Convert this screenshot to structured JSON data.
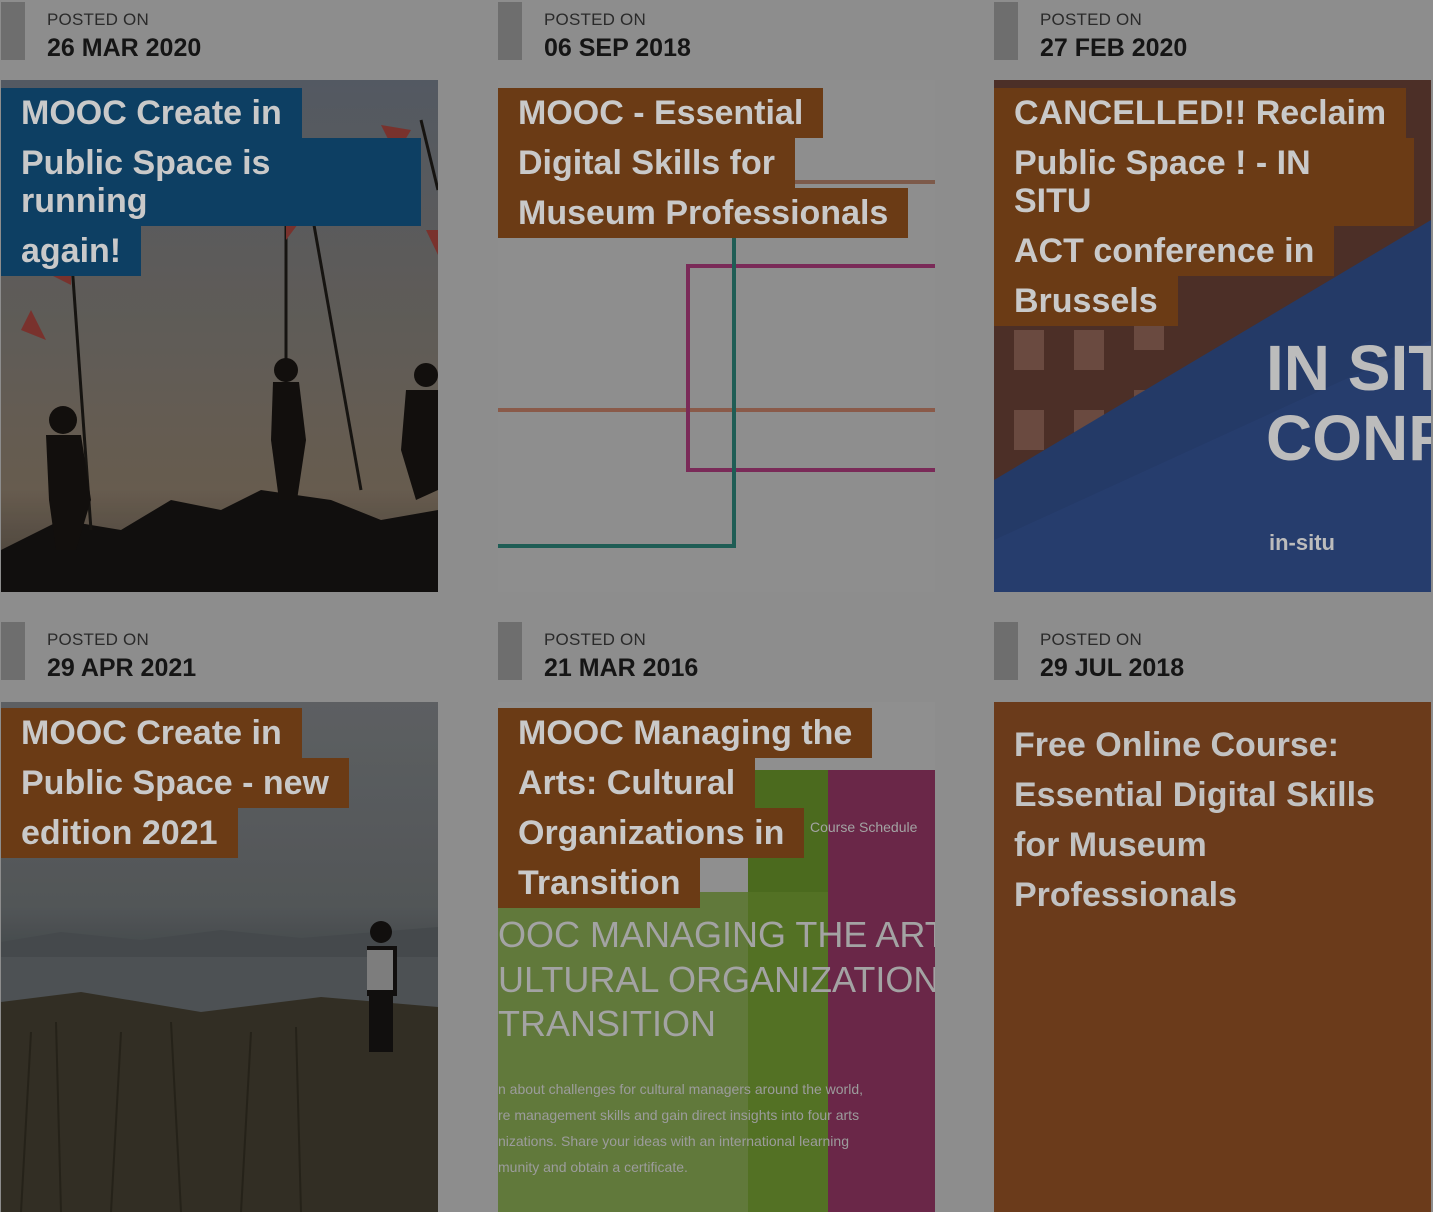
{
  "cards": [
    {
      "posted_label": "POSTED ON",
      "date": "26 MAR 2020",
      "title_lines": [
        "MOOC Create in",
        "Public Space is running",
        "again!"
      ]
    },
    {
      "posted_label": "POSTED ON",
      "date": "06 SEP 2018",
      "title_lines": [
        "MOOC - Essential",
        "Digital Skills for",
        "Museum Professionals"
      ]
    },
    {
      "posted_label": "POSTED ON",
      "date": "27 FEB 2020",
      "title_lines": [
        "CANCELLED!! Reclaim",
        "Public Space ! - IN SITU",
        "ACT conference in",
        "Brussels"
      ],
      "image_text": [
        "IN SIT",
        "CONF",
        "in-situ"
      ]
    },
    {
      "posted_label": "POSTED ON",
      "date": "29 APR 2021",
      "title_lines": [
        "MOOC Create in",
        "Public Space - new",
        "edition 2021"
      ]
    },
    {
      "posted_label": "POSTED ON",
      "date": "21 MAR 2016",
      "title_lines": [
        "MOOC Managing the",
        "Arts: Cultural",
        "Organizations in",
        "Transition"
      ],
      "image_text": {
        "schedule": "Course Schedule",
        "heading": [
          "OOC MANAGING THE ARTS",
          "ULTURAL ORGANIZATIONS",
          " TRANSITION"
        ],
        "body": [
          "n about challenges for cultural managers around the world,",
          "re management skills and gain direct insights into four arts",
          "nizations. Share your ideas with an international learning",
          "munity and obtain a certificate."
        ]
      }
    },
    {
      "posted_label": "POSTED ON",
      "date": "29 JUL 2018",
      "title_lines": [
        "Free Online Course:",
        "Essential Digital Skills",
        "for Museum",
        "Professionals"
      ]
    }
  ],
  "colors": {
    "overlay_gray": "#8d8d8d",
    "title_blue": "#0d3f63",
    "title_brown": "#6b3b15"
  }
}
